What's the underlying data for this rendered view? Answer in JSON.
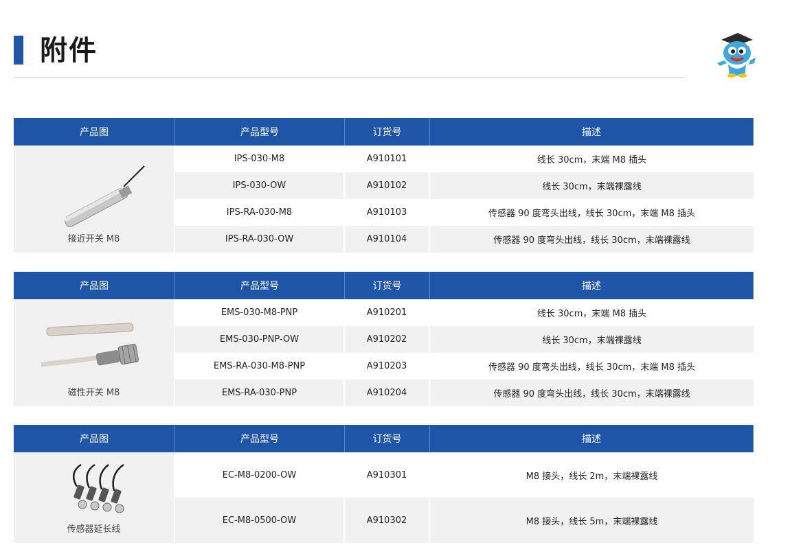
{
  "page": {
    "title": "附件"
  },
  "headers": [
    "产品图",
    "产品型号",
    "订货号",
    "描述"
  ],
  "tables": [
    {
      "caption": "接近开关 M8",
      "image": "proximity-switch-image",
      "rows": [
        {
          "model": "IPS-030-M8",
          "order": "A910101",
          "desc": "线长 30cm，末端 M8 插头"
        },
        {
          "model": "IPS-030-OW",
          "order": "A910102",
          "desc": "线长 30cm，末端裸露线"
        },
        {
          "model": "IPS-RA-030-M8",
          "order": "A910103",
          "desc": "传感器 90 度弯头出线，线长 30cm，末端 M8 插头"
        },
        {
          "model": "IPS-RA-030-OW",
          "order": "A910104",
          "desc": "传感器 90 度弯头出线，线长 30cm，末端裸露线"
        }
      ]
    },
    {
      "caption": "磁性开关 M8",
      "image": "magnetic-switch-image",
      "rows": [
        {
          "model": "EMS-030-M8-PNP",
          "order": "A910201",
          "desc": "线长 30cm，末端 M8 插头"
        },
        {
          "model": "EMS-030-PNP-OW",
          "order": "A910202",
          "desc": "线长 30cm，末端裸露线"
        },
        {
          "model": "EMS-RA-030-M8-PNP",
          "order": "A910203",
          "desc": "传感器 90 度弯头出线，线长 30cm，末端 M8 插头"
        },
        {
          "model": "EMS-RA-030-PNP",
          "order": "A910204",
          "desc": "传感器 90 度弯头出线，线长 30cm，末端裸露线"
        }
      ]
    },
    {
      "caption": "传感器延长线",
      "image": "extension-cable-image",
      "rows": [
        {
          "model": "EC-M8-0200-OW",
          "order": "A910301",
          "desc": "M8 接头，线长 2m，末端裸露线"
        },
        {
          "model": "EC-M8-0500-OW",
          "order": "A910302",
          "desc": "M8 接头，线长 5m，末端裸露线"
        }
      ]
    }
  ],
  "colors": {
    "header_bg": "#1e55a6",
    "row_alt": "#f1f1f1",
    "accent": "#1e55a6"
  }
}
